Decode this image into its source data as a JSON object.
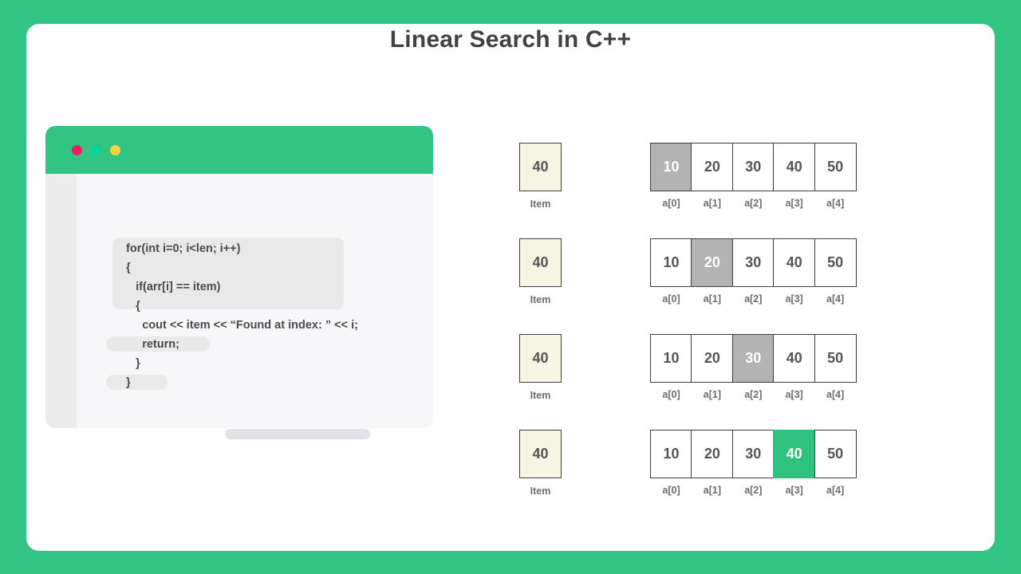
{
  "theme": {
    "background_color": "#31c482",
    "card_color": "#ffffff",
    "accent_green": "#2ec27e",
    "highlight_gray": "#b3b3b3",
    "item_box_color": "#f5f5e1",
    "text_color": "#555555"
  },
  "header": {
    "title": "Linear Search in C++"
  },
  "code_window": {
    "dots": [
      {
        "name": "close-dot",
        "color": "#ec1e63"
      },
      {
        "name": "minimize-dot",
        "color": "#00d49a"
      },
      {
        "name": "maximize-dot",
        "color": "#f6d43f"
      }
    ],
    "lines": [
      "  for(int i=0; i<len; i++)",
      "  {",
      "     if(arr[i] == item)",
      "     {",
      "       cout << item << “Found at index: ” << i;",
      "       return;",
      "     }",
      "  }"
    ]
  },
  "steps": [
    {
      "item_value": "40",
      "item_label": "Item",
      "cells": [
        {
          "value": "10",
          "state": "compare"
        },
        {
          "value": "20",
          "state": "normal"
        },
        {
          "value": "30",
          "state": "normal"
        },
        {
          "value": "40",
          "state": "normal"
        },
        {
          "value": "50",
          "state": "normal"
        }
      ],
      "indices": [
        "a[0]",
        "a[1]",
        "a[2]",
        "a[3]",
        "a[4]"
      ]
    },
    {
      "item_value": "40",
      "item_label": "Item",
      "cells": [
        {
          "value": "10",
          "state": "normal"
        },
        {
          "value": "20",
          "state": "compare"
        },
        {
          "value": "30",
          "state": "normal"
        },
        {
          "value": "40",
          "state": "normal"
        },
        {
          "value": "50",
          "state": "normal"
        }
      ],
      "indices": [
        "a[0]",
        "a[1]",
        "a[2]",
        "a[3]",
        "a[4]"
      ]
    },
    {
      "item_value": "40",
      "item_label": "Item",
      "cells": [
        {
          "value": "10",
          "state": "normal"
        },
        {
          "value": "20",
          "state": "normal"
        },
        {
          "value": "30",
          "state": "compare"
        },
        {
          "value": "40",
          "state": "normal"
        },
        {
          "value": "50",
          "state": "normal"
        }
      ],
      "indices": [
        "a[0]",
        "a[1]",
        "a[2]",
        "a[3]",
        "a[4]"
      ]
    },
    {
      "item_value": "40",
      "item_label": "Item",
      "cells": [
        {
          "value": "10",
          "state": "normal"
        },
        {
          "value": "20",
          "state": "normal"
        },
        {
          "value": "30",
          "state": "normal"
        },
        {
          "value": "40",
          "state": "found"
        },
        {
          "value": "50",
          "state": "normal"
        }
      ],
      "indices": [
        "a[0]",
        "a[1]",
        "a[2]",
        "a[3]",
        "a[4]"
      ]
    }
  ]
}
